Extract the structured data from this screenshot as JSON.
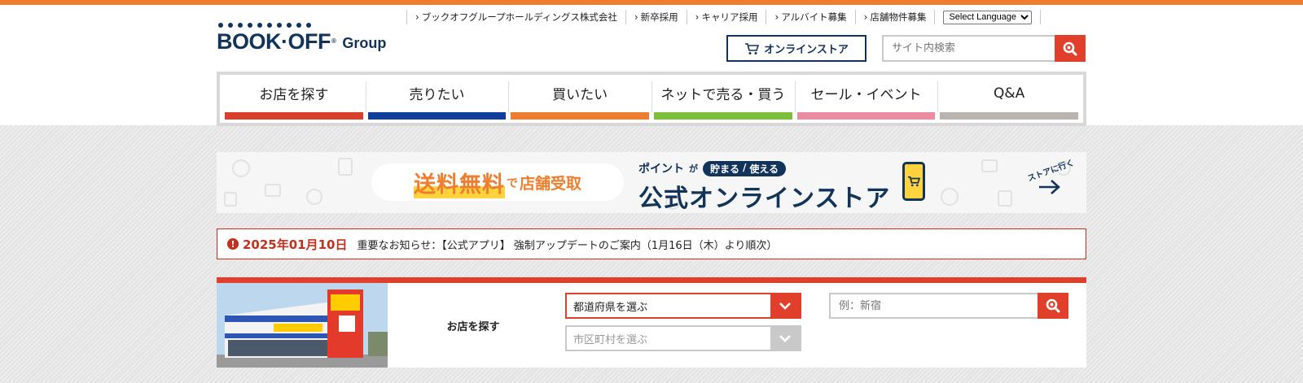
{
  "brand": {
    "logo_text": "BOOK·OFF",
    "logo_group": "Group",
    "top_bar_color": "#ef7d2e",
    "navy": "#12335a",
    "red": "#e0402b"
  },
  "utility_links": [
    {
      "label": "ブックオフグループホールディングス株式会社"
    },
    {
      "label": "新卒採用"
    },
    {
      "label": "キャリア採用"
    },
    {
      "label": "アルバイト募集"
    },
    {
      "label": "店舗物件募集"
    }
  ],
  "language": {
    "selected": "Select Language"
  },
  "header": {
    "online_store_label": "オンラインストア",
    "search_placeholder": "サイト内検索",
    "icons": {
      "cart": "cart-icon",
      "search": "search-icon"
    }
  },
  "nav": [
    {
      "label": "お店を探す",
      "color": "#d9402c"
    },
    {
      "label": "売りたい",
      "color": "#0f3e9c"
    },
    {
      "label": "買いたい",
      "color": "#ef7d2e"
    },
    {
      "label": "ネットで売る・買う",
      "color": "#7cbf3a"
    },
    {
      "label": "セール・イベント",
      "color": "#ec8ba0"
    },
    {
      "label": "Q&A",
      "color": "#b9b5ae"
    }
  ],
  "banner": {
    "free_shipping": "送料無料",
    "de": "で",
    "store_pickup": "店舗受取",
    "points": "ポイント",
    "ga": "が",
    "tamaru": "貯まる",
    "tsukaeru": "使える",
    "title": "公式オンラインストア",
    "goto": "ストアに行く"
  },
  "notice": {
    "date": "2025年01月10日",
    "text": "重要なお知らせ：【公式アプリ】 強制アップデートのご案内（1月16日（木）より順次）"
  },
  "store_search": {
    "label": "お店を探す",
    "prefecture": "都道府県を選ぶ",
    "city": "市区町村を選ぶ",
    "keyword_placeholder": "例：新宿"
  }
}
